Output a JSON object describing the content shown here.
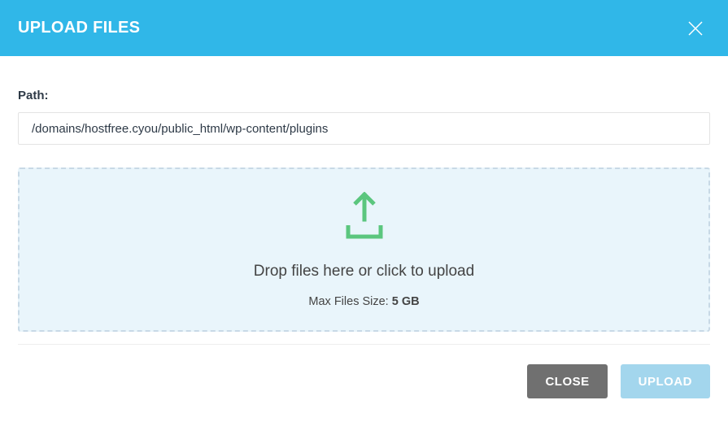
{
  "header": {
    "title": "UPLOAD FILES"
  },
  "pathSection": {
    "label": "Path:",
    "value": "/domains/hostfree.cyou/public_html/wp-content/plugins"
  },
  "dropzone": {
    "mainText": "Drop files here or click to upload",
    "maxSizeLabel": "Max Files Size:",
    "maxSizeValue": "5 GB"
  },
  "footer": {
    "closeLabel": "CLOSE",
    "uploadLabel": "UPLOAD"
  }
}
